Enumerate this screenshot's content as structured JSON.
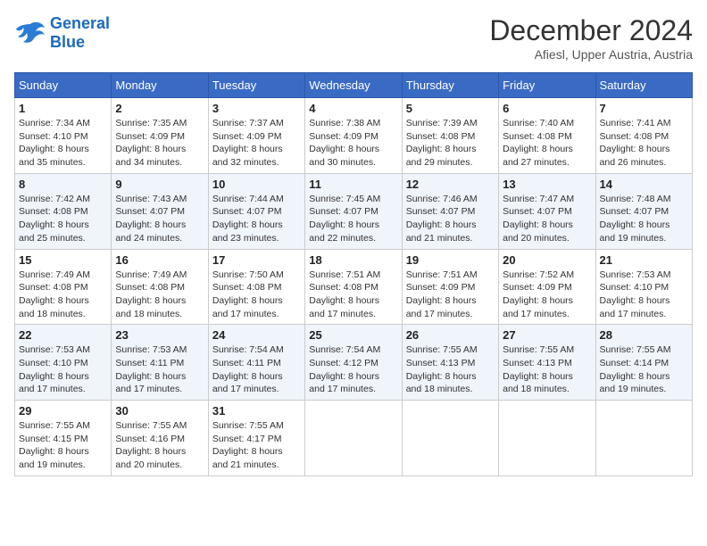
{
  "header": {
    "logo_line1": "General",
    "logo_line2": "Blue",
    "month_title": "December 2024",
    "subtitle": "Afiesl, Upper Austria, Austria"
  },
  "days_of_week": [
    "Sunday",
    "Monday",
    "Tuesday",
    "Wednesday",
    "Thursday",
    "Friday",
    "Saturday"
  ],
  "weeks": [
    [
      {
        "day": "1",
        "sunrise": "7:34 AM",
        "sunset": "4:10 PM",
        "daylight": "8 hours and 35 minutes."
      },
      {
        "day": "2",
        "sunrise": "7:35 AM",
        "sunset": "4:09 PM",
        "daylight": "8 hours and 34 minutes."
      },
      {
        "day": "3",
        "sunrise": "7:37 AM",
        "sunset": "4:09 PM",
        "daylight": "8 hours and 32 minutes."
      },
      {
        "day": "4",
        "sunrise": "7:38 AM",
        "sunset": "4:09 PM",
        "daylight": "8 hours and 30 minutes."
      },
      {
        "day": "5",
        "sunrise": "7:39 AM",
        "sunset": "4:08 PM",
        "daylight": "8 hours and 29 minutes."
      },
      {
        "day": "6",
        "sunrise": "7:40 AM",
        "sunset": "4:08 PM",
        "daylight": "8 hours and 27 minutes."
      },
      {
        "day": "7",
        "sunrise": "7:41 AM",
        "sunset": "4:08 PM",
        "daylight": "8 hours and 26 minutes."
      }
    ],
    [
      {
        "day": "8",
        "sunrise": "7:42 AM",
        "sunset": "4:08 PM",
        "daylight": "8 hours and 25 minutes."
      },
      {
        "day": "9",
        "sunrise": "7:43 AM",
        "sunset": "4:07 PM",
        "daylight": "8 hours and 24 minutes."
      },
      {
        "day": "10",
        "sunrise": "7:44 AM",
        "sunset": "4:07 PM",
        "daylight": "8 hours and 23 minutes."
      },
      {
        "day": "11",
        "sunrise": "7:45 AM",
        "sunset": "4:07 PM",
        "daylight": "8 hours and 22 minutes."
      },
      {
        "day": "12",
        "sunrise": "7:46 AM",
        "sunset": "4:07 PM",
        "daylight": "8 hours and 21 minutes."
      },
      {
        "day": "13",
        "sunrise": "7:47 AM",
        "sunset": "4:07 PM",
        "daylight": "8 hours and 20 minutes."
      },
      {
        "day": "14",
        "sunrise": "7:48 AM",
        "sunset": "4:07 PM",
        "daylight": "8 hours and 19 minutes."
      }
    ],
    [
      {
        "day": "15",
        "sunrise": "7:49 AM",
        "sunset": "4:08 PM",
        "daylight": "8 hours and 18 minutes."
      },
      {
        "day": "16",
        "sunrise": "7:49 AM",
        "sunset": "4:08 PM",
        "daylight": "8 hours and 18 minutes."
      },
      {
        "day": "17",
        "sunrise": "7:50 AM",
        "sunset": "4:08 PM",
        "daylight": "8 hours and 17 minutes."
      },
      {
        "day": "18",
        "sunrise": "7:51 AM",
        "sunset": "4:08 PM",
        "daylight": "8 hours and 17 minutes."
      },
      {
        "day": "19",
        "sunrise": "7:51 AM",
        "sunset": "4:09 PM",
        "daylight": "8 hours and 17 minutes."
      },
      {
        "day": "20",
        "sunrise": "7:52 AM",
        "sunset": "4:09 PM",
        "daylight": "8 hours and 17 minutes."
      },
      {
        "day": "21",
        "sunrise": "7:53 AM",
        "sunset": "4:10 PM",
        "daylight": "8 hours and 17 minutes."
      }
    ],
    [
      {
        "day": "22",
        "sunrise": "7:53 AM",
        "sunset": "4:10 PM",
        "daylight": "8 hours and 17 minutes."
      },
      {
        "day": "23",
        "sunrise": "7:53 AM",
        "sunset": "4:11 PM",
        "daylight": "8 hours and 17 minutes."
      },
      {
        "day": "24",
        "sunrise": "7:54 AM",
        "sunset": "4:11 PM",
        "daylight": "8 hours and 17 minutes."
      },
      {
        "day": "25",
        "sunrise": "7:54 AM",
        "sunset": "4:12 PM",
        "daylight": "8 hours and 17 minutes."
      },
      {
        "day": "26",
        "sunrise": "7:55 AM",
        "sunset": "4:13 PM",
        "daylight": "8 hours and 18 minutes."
      },
      {
        "day": "27",
        "sunrise": "7:55 AM",
        "sunset": "4:13 PM",
        "daylight": "8 hours and 18 minutes."
      },
      {
        "day": "28",
        "sunrise": "7:55 AM",
        "sunset": "4:14 PM",
        "daylight": "8 hours and 19 minutes."
      }
    ],
    [
      {
        "day": "29",
        "sunrise": "7:55 AM",
        "sunset": "4:15 PM",
        "daylight": "8 hours and 19 minutes."
      },
      {
        "day": "30",
        "sunrise": "7:55 AM",
        "sunset": "4:16 PM",
        "daylight": "8 hours and 20 minutes."
      },
      {
        "day": "31",
        "sunrise": "7:55 AM",
        "sunset": "4:17 PM",
        "daylight": "8 hours and 21 minutes."
      },
      null,
      null,
      null,
      null
    ]
  ]
}
